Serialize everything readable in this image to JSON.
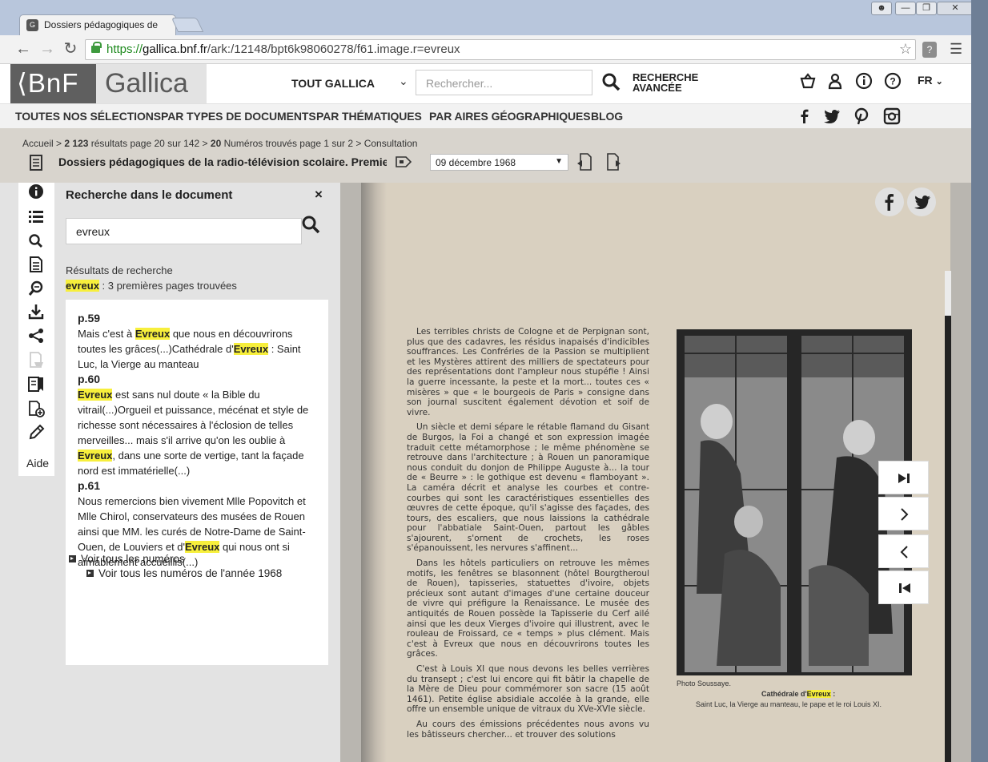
{
  "browser": {
    "tab_title": "Dossiers pédagogiques de",
    "url_scheme": "https://",
    "url_host": "gallica.bnf.fr",
    "url_path": "/ark:/12148/bpt6k98060278/f61.image.r=evreux"
  },
  "header": {
    "logo_bnf": "⟨BnF",
    "logo_gallica": "Gallica",
    "scope_label": "TOUT GALLICA",
    "search_placeholder": "Rechercher...",
    "advanced_line1": "RECHERCHE",
    "advanced_line2": "AVANCÉE",
    "lang": "FR"
  },
  "menu": [
    "TOUTES NOS SÉLECTIONS",
    "PAR TYPES DE DOCUMENTS",
    "PAR THÉMATIQUES",
    "PAR AIRES GÉOGRAPHIQUES",
    "BLOG"
  ],
  "breadcrumb": {
    "home": "Accueil",
    "results_count": "2 123",
    "results_text": "résultats page 20 sur 142",
    "issues_count": "20",
    "issues_text": "Numéros trouvés page 1 sur 2",
    "current": "Consultation",
    "sep": ">"
  },
  "document": {
    "title": "Dossiers pédagogiques de la radio-télévision scolaire. Premier ...",
    "date": "09 décembre 1968"
  },
  "search_panel": {
    "title": "Recherche dans le document",
    "close": "×",
    "query": "evreux",
    "results_label": "Résultats de recherche",
    "summary_term": "evreux",
    "summary_text": " : 3 premières pages trouvées",
    "results": [
      {
        "page": "p.59",
        "before": "Mais c'est à ",
        "hit": "Evreux",
        "after": " que nous en découvrirons toutes les grâces(...)Cathédrale d'",
        "hit2": "Evreux",
        "after2": " : Saint Luc, la Vierge au manteau"
      },
      {
        "page": "p.60",
        "before": "",
        "hit": "Evreux",
        "after": " est sans nul doute « la Bible du vitrail(...)Orgueil et puissance, mécénat et style de richesse sont nécessaires à l'éclosion de telles merveilles... mais s'il arrive qu'on les oublie à ",
        "hit2": "Evreux",
        "after2": ", dans une sorte de vertige, tant la façade nord est immatérielle(...)"
      },
      {
        "page": "p.61",
        "before": "Nous remercions bien vivement Mlle Popovitch et Mlle Chirol, conservateurs des musées de Rouen ainsi que MM. les curés de Notre-Dame de Saint-Ouen, de Louviers et d'",
        "hit": "Evreux",
        "after": " qui nous ont si aimablement accueillis(...)",
        "hit2": "",
        "after2": ""
      }
    ],
    "link_all": "Voir tous les numéros",
    "link_year": "Voir tous les numéros de l'année 1968"
  },
  "sidebar": {
    "help": "Aide"
  },
  "scan": {
    "paragraphs": [
      "Les terribles christs de Cologne et de Perpignan sont, plus que des cadavres, les résidus inapaisés d'indicibles souffrances. Les Confréries de la Passion se multiplient et les Mystères attirent des milliers de spectateurs pour des représentations dont l'ampleur nous stupéfie ! Ainsi la guerre incessante, la peste et la mort... toutes ces « misères » que « le bourgeois de Paris » consigne dans son journal suscitent également dévotion et soif de vivre.",
      "Un siècle et demi sépare le rétable flamand du Gisant de Burgos, la Foi a changé et son expression imagée traduit cette métamorphose ; le même phénomène se retrouve dans l'architecture ; à Rouen un panoramique nous conduit du donjon de Philippe Auguste à... la tour de « Beurre » : le gothique est devenu « flamboyant ». La caméra décrit et analyse les courbes et contre-courbes qui sont les caractéristiques essentielles des œuvres de cette époque, qu'il s'agisse des façades, des tours, des escaliers, que nous laissions la cathédrale pour l'abbatiale Saint-Ouen, partout les gâbles s'ajourent, s'ornent de crochets, les roses s'épanouissent, les nervures s'affinent...",
      "Dans les hôtels particuliers on retrouve les mêmes motifs, les fenêtres se blasonnent (hôtel Bourgtheroul de Rouen), tapisseries, statuettes d'ivoire, objets précieux sont autant d'images d'une certaine douceur de vivre qui préfigure la Renaissance. Le musée des antiquités de Rouen possède la Tapisserie du Cerf ailé ainsi que les deux Vierges d'ivoire qui illustrent, avec le rouleau de Froissard, ce « temps » plus clément. Mais c'est à Evreux que nous en découvrirons toutes les grâces.",
      "C'est à Louis XI que nous devons les belles verrières du transept ; c'est lui encore qui fit bâtir la chapelle de la Mère de Dieu pour commémorer son sacre (15 août 1461). Petite église absidiale accolée à la grande, elle offre un ensemble unique de vitraux du XVe-XVIe siècle.",
      "Au cours des émissions précédentes nous avons vu les bâtisseurs chercher... et trouver des solutions"
    ],
    "photo_credit": "Photo Soussaye.",
    "caption_prefix": "Cathédrale d'",
    "caption_hit": "Evreux",
    "caption_suffix": " :",
    "caption_line2": "Saint Luc, la Vierge au manteau, le pape et le roi Louis XI."
  },
  "colors": {
    "highlight": "#f7ef3c",
    "brand_dark": "#5f5f5f",
    "docbar": "#d8d4cd"
  }
}
